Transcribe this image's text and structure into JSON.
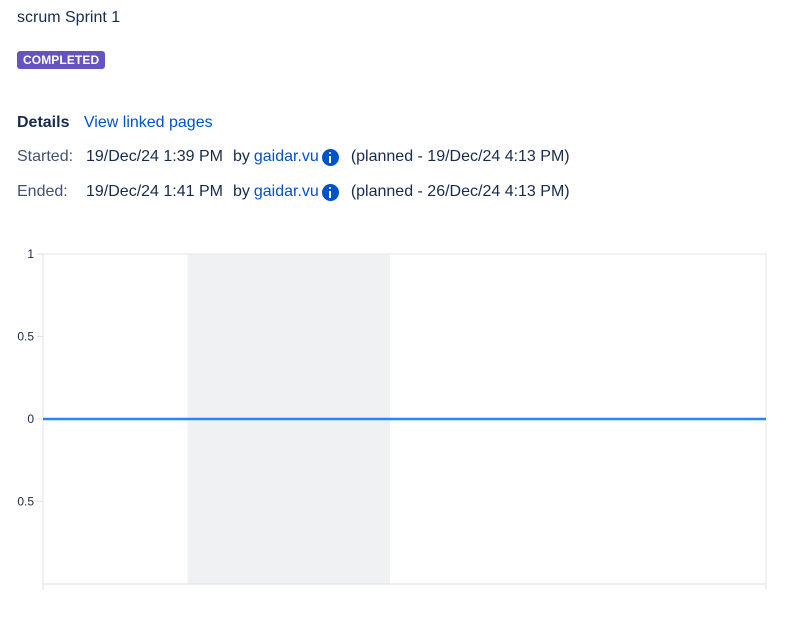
{
  "sprint": {
    "name": "scrum Sprint 1",
    "status": "COMPLETED",
    "status_color": "#6554c0"
  },
  "details": {
    "label": "Details",
    "linked_pages_link": "View linked pages"
  },
  "started": {
    "label": "Started:",
    "time": "19/Dec/24 1:39 PM",
    "by": "by",
    "user": "gaidar.vu",
    "planned": "(planned - 19/Dec/24 4:13 PM)"
  },
  "ended": {
    "label": "Ended:",
    "time": "19/Dec/24 1:41 PM",
    "by": "by",
    "user": "gaidar.vu",
    "planned": "(planned - 26/Dec/24 4:13 PM)"
  },
  "chart_data": {
    "type": "line",
    "ytick_labels": [
      "1",
      "0.5",
      "0",
      "0.5"
    ],
    "ylim": [
      -1,
      1
    ],
    "series": [
      {
        "values": [
          0,
          0
        ],
        "color": "#2684ff"
      }
    ],
    "non_working_band": [
      0.2,
      0.48
    ],
    "grid": false
  }
}
